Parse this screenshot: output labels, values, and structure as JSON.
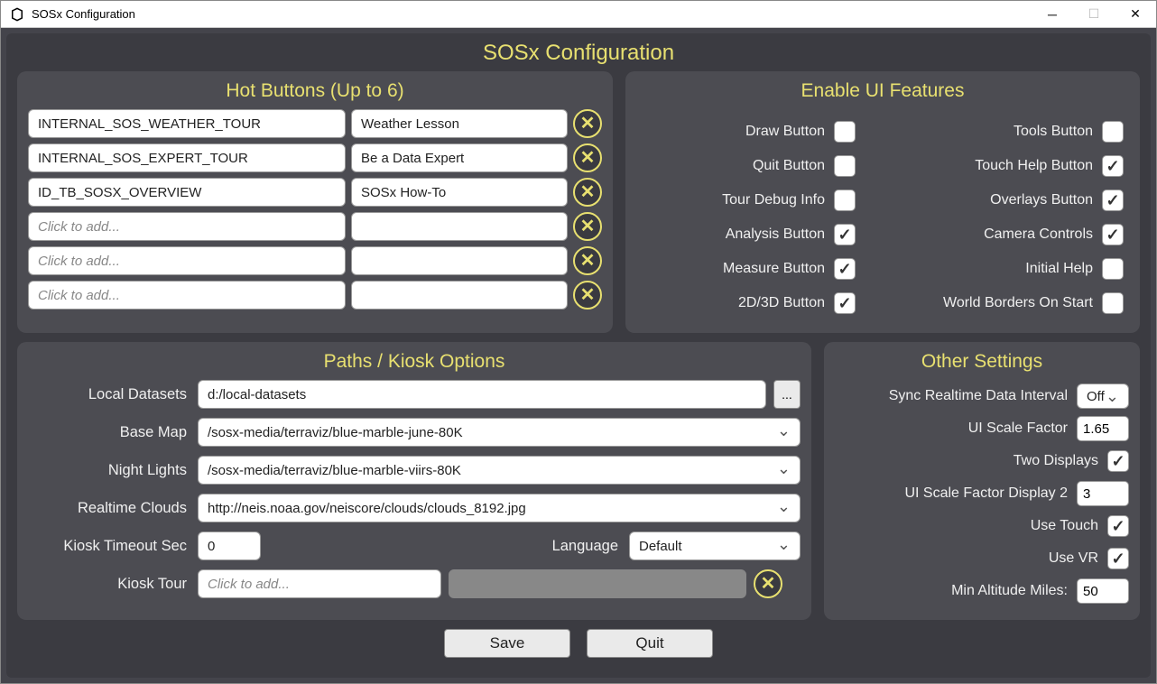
{
  "window": {
    "title": "SOSx Configuration"
  },
  "main_title": "SOSx Configuration",
  "hot_buttons": {
    "title": "Hot Buttons (Up to 6)",
    "placeholder": "Click to add...",
    "rows": [
      {
        "id": "INTERNAL_SOS_WEATHER_TOUR",
        "label": "Weather Lesson"
      },
      {
        "id": "INTERNAL_SOS_EXPERT_TOUR",
        "label": "Be a Data Expert"
      },
      {
        "id": "ID_TB_SOSX_OVERVIEW",
        "label": "SOSx How-To"
      },
      {
        "id": "",
        "label": ""
      },
      {
        "id": "",
        "label": ""
      },
      {
        "id": "",
        "label": ""
      }
    ]
  },
  "features": {
    "title": "Enable UI Features",
    "left": [
      {
        "label": "Draw Button",
        "checked": false
      },
      {
        "label": "Quit Button",
        "checked": false
      },
      {
        "label": "Tour Debug Info",
        "checked": false
      },
      {
        "label": "Analysis Button",
        "checked": true
      },
      {
        "label": "Measure Button",
        "checked": true
      },
      {
        "label": "2D/3D Button",
        "checked": true
      }
    ],
    "right": [
      {
        "label": "Tools Button",
        "checked": false
      },
      {
        "label": "Touch Help Button",
        "checked": true
      },
      {
        "label": "Overlays Button",
        "checked": true
      },
      {
        "label": "Camera Controls",
        "checked": true
      },
      {
        "label": "Initial Help",
        "checked": false
      },
      {
        "label": "World Borders On Start",
        "checked": false
      }
    ]
  },
  "paths": {
    "title": "Paths / Kiosk Options",
    "local_datasets_label": "Local Datasets",
    "local_datasets": "d:/local-datasets",
    "browse": "...",
    "base_map_label": "Base Map",
    "base_map": "/sosx-media/terraviz/blue-marble-june-80K",
    "night_lights_label": "Night Lights",
    "night_lights": "/sosx-media/terraviz/blue-marble-viirs-80K",
    "realtime_clouds_label": "Realtime Clouds",
    "realtime_clouds": "http://neis.noaa.gov/neiscore/clouds/clouds_8192.jpg",
    "kiosk_timeout_label": "Kiosk Timeout Sec",
    "kiosk_timeout": "0",
    "language_label": "Language",
    "language": "Default",
    "kiosk_tour_label": "Kiosk Tour",
    "kiosk_tour_placeholder": "Click to add..."
  },
  "other": {
    "title": "Other Settings",
    "sync_label": "Sync Realtime Data Interval",
    "sync_value": "Off",
    "ui_scale_label": "UI Scale Factor",
    "ui_scale": "1.65",
    "two_displays_label": "Two Displays",
    "two_displays": true,
    "ui_scale2_label": "UI Scale Factor Display 2",
    "ui_scale2": "3",
    "use_touch_label": "Use Touch",
    "use_touch": true,
    "use_vr_label": "Use VR",
    "use_vr": true,
    "min_alt_label": "Min Altitude Miles:",
    "min_alt": "50"
  },
  "buttons": {
    "save": "Save",
    "quit": "Quit"
  }
}
